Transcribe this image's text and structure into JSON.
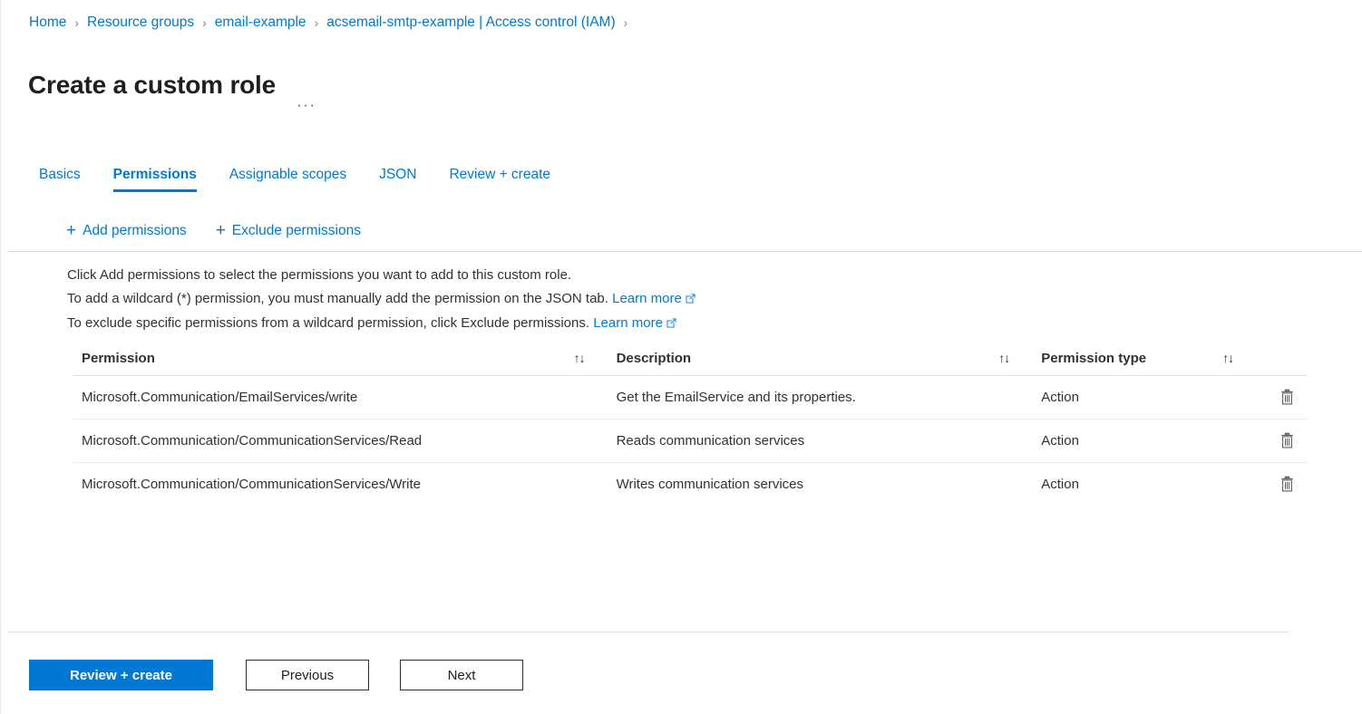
{
  "breadcrumb": {
    "items": [
      {
        "label": "Home"
      },
      {
        "label": "Resource groups"
      },
      {
        "label": "email-example"
      },
      {
        "label": "acsemail-smtp-example | Access control (IAM)"
      }
    ],
    "separator": "›"
  },
  "header": {
    "title": "Create a custom role",
    "more_options": "···"
  },
  "tabs": [
    {
      "label": "Basics",
      "active": false
    },
    {
      "label": "Permissions",
      "active": true
    },
    {
      "label": "Assignable scopes",
      "active": false
    },
    {
      "label": "JSON",
      "active": false
    },
    {
      "label": "Review + create",
      "active": false
    }
  ],
  "commandbar": {
    "add_permissions": "Add permissions",
    "exclude_permissions": "Exclude permissions",
    "plus": "+"
  },
  "instructions": {
    "line1": "Click Add permissions to select the permissions you want to add to this custom role.",
    "line2_prefix": "To add a wildcard (*) permission, you must manually add the permission on the JSON tab.",
    "line2_link": "Learn more",
    "line3_prefix": "To exclude specific permissions from a wildcard permission, click Exclude permissions.",
    "line3_link": "Learn more"
  },
  "table": {
    "columns": {
      "permission": "Permission",
      "description": "Description",
      "permission_type": "Permission type"
    },
    "sort_icon": "↑↓",
    "rows": [
      {
        "permission": "Microsoft.Communication/EmailServices/write",
        "description": "Get the EmailService and its properties.",
        "type": "Action"
      },
      {
        "permission": "Microsoft.Communication/CommunicationServices/Read",
        "description": "Reads communication services",
        "type": "Action"
      },
      {
        "permission": "Microsoft.Communication/CommunicationServices/Write",
        "description": "Writes communication services",
        "type": "Action"
      }
    ]
  },
  "footer": {
    "review_create": "Review + create",
    "previous": "Previous",
    "next": "Next"
  },
  "colors": {
    "accent": "#0078d4",
    "text": "#323130",
    "border": "#e1dfdd"
  }
}
